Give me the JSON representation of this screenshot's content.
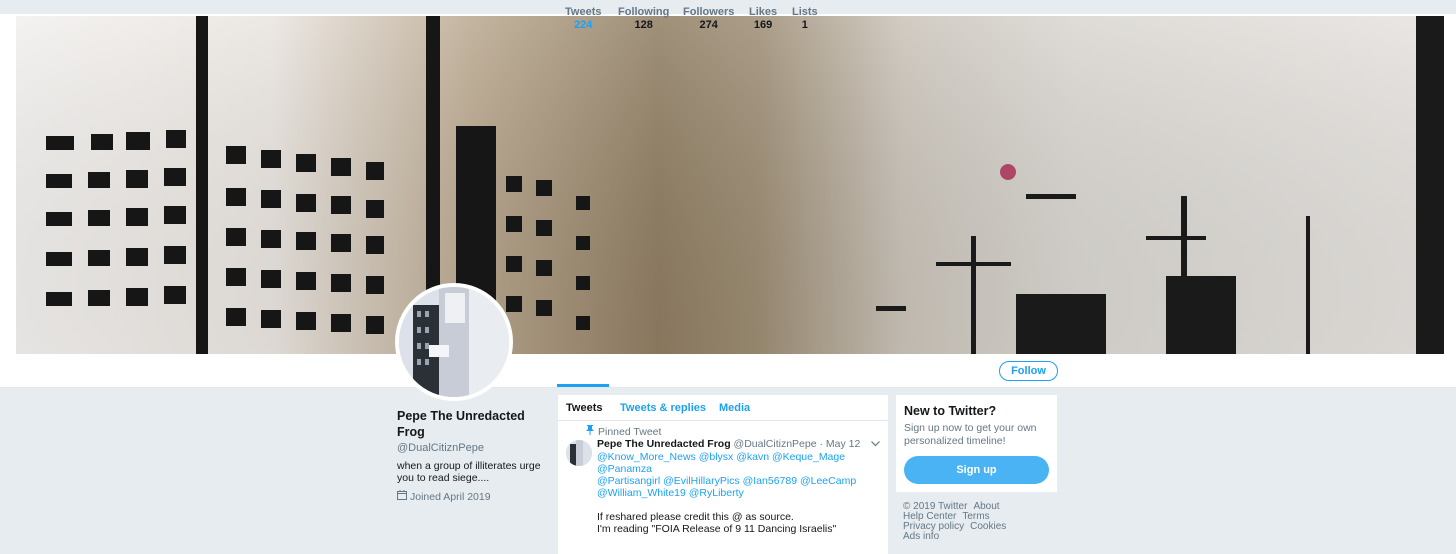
{
  "profile": {
    "name": "Pepe The Unredacted Frog",
    "handle": "@DualCitiznPepe",
    "bio": "when a group of illiterates urge you to read siege....",
    "joined": "Joined April 2019"
  },
  "stats": [
    {
      "label": "Tweets",
      "value": "224"
    },
    {
      "label": "Following",
      "value": "128"
    },
    {
      "label": "Followers",
      "value": "274"
    },
    {
      "label": "Likes",
      "value": "169"
    },
    {
      "label": "Lists",
      "value": "1"
    }
  ],
  "follow_label": "Follow",
  "timeline": {
    "tabs": [
      "Tweets",
      "Tweets & replies",
      "Media"
    ],
    "pinned_label": "Pinned Tweet",
    "tweet": {
      "name": "Pepe The Unredacted Frog",
      "meta": "@DualCitiznPepe · May 12",
      "mentions_line1": "@Know_More_News @blysx @kavn @Keque_Mage @Panamza",
      "mentions_line2": "@Partisangirl @EvilHillaryPics @Ian56789 @LeeCamp",
      "mentions_line3": "@William_White19 @RyLiberty",
      "text_line1": "If reshared please credit this @ as source.",
      "text_line2": "I'm reading \"FOIA Release of 9 11 Dancing Israelis\""
    }
  },
  "sidebar": {
    "title": "New to Twitter?",
    "text": "Sign up now to get your own personalized timeline!",
    "signup_label": "Sign up"
  },
  "footer": {
    "copyright": "© 2019 Twitter",
    "about": "About",
    "help": "Help Center",
    "terms": "Terms",
    "privacy": "Privacy policy",
    "cookies": "Cookies",
    "ads": "Ads info"
  },
  "colors": {
    "accent": "#1da1f2",
    "signup": "#4ab3f4",
    "background": "#e6ecf0"
  }
}
